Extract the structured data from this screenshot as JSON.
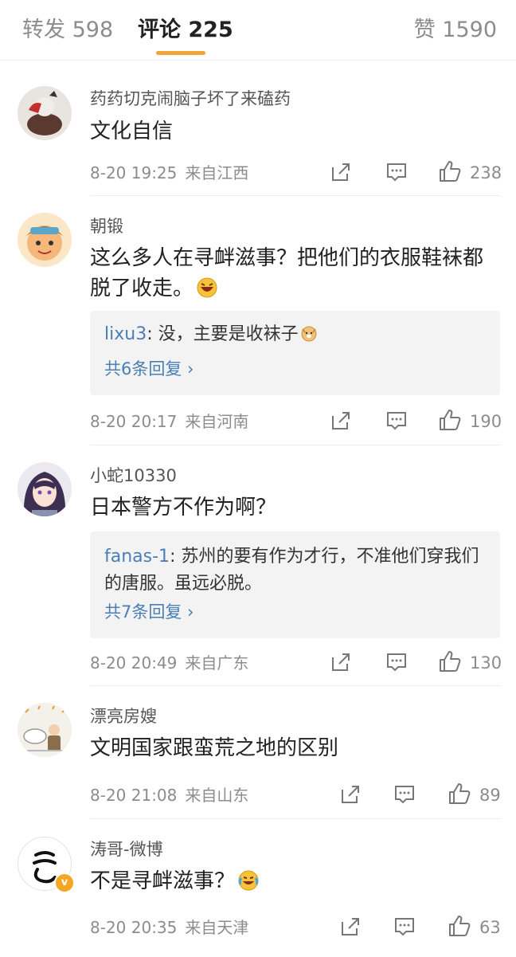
{
  "tabs": {
    "repost": "转发 598",
    "comments": "评论 225",
    "likes": "赞 1590",
    "active_color": "#f2a33a"
  },
  "comments": [
    {
      "username": "药药切克闹脑子坏了来磕药",
      "text": "文化自信",
      "time": "8-20 19:25",
      "location": "来自江西",
      "likes": "238",
      "avatar": "avatar-illustration"
    },
    {
      "username": "朝锻",
      "text": "这么多人在寻衅滋事？把他们的衣服鞋袜都脱了收走。",
      "text_emoji": "laughing-emoji",
      "reply": {
        "user": "lixu3",
        "text": ": 没，主要是收袜子",
        "emoji": "doge-emoji",
        "more": "共6条回复 ›"
      },
      "time": "8-20 20:17",
      "location": "来自河南",
      "likes": "190",
      "avatar": "avatar-cartoon-boy"
    },
    {
      "username": "小蛇10330",
      "text": "日本警方不作为啊？",
      "reply": {
        "user": "fanas-1",
        "text": ": 苏州的要有作为才行，不准他们穿我们的唐服。虽远必脱。",
        "more": "共7条回复 ›"
      },
      "time": "8-20 20:49",
      "location": "来自广东",
      "likes": "130",
      "avatar": "avatar-anime"
    },
    {
      "username": "漂亮房嫂",
      "text": "文明国家跟蛮荒之地的区别",
      "time": "8-20 21:08",
      "location": "来自山东",
      "likes": "89",
      "avatar": "avatar-cartoon-room"
    },
    {
      "username": "涛哥-微博",
      "text": "不是寻衅滋事？",
      "text_emoji": "crying-laughing-emoji",
      "time": "8-20 20:35",
      "location": "来自天津",
      "likes": "63",
      "avatar": "avatar-calligraphy",
      "verified_badge": "v"
    }
  ],
  "colors": {
    "link": "#4a7fb5",
    "meta": "#8c8c8c",
    "reply_bg": "#f3f3f3"
  }
}
